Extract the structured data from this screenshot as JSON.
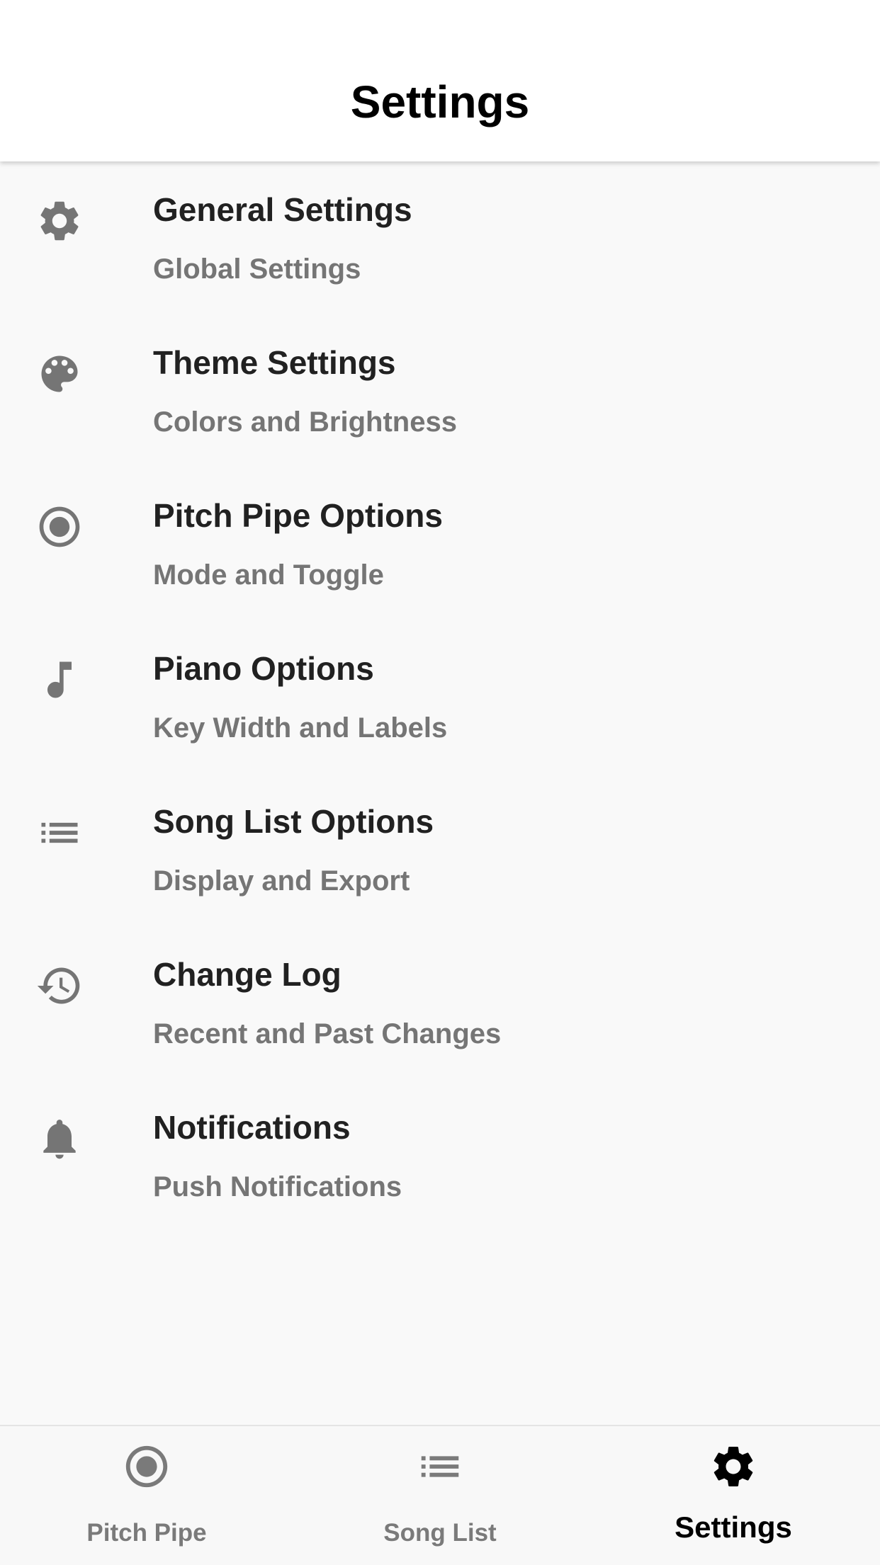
{
  "header": {
    "title": "Settings"
  },
  "items": [
    {
      "title": "General Settings",
      "subtitle": "Global Settings",
      "icon": "gear-icon"
    },
    {
      "title": "Theme Settings",
      "subtitle": "Colors and Brightness",
      "icon": "palette-icon"
    },
    {
      "title": "Pitch Pipe Options",
      "subtitle": "Mode and Toggle",
      "icon": "radio-button-icon"
    },
    {
      "title": "Piano Options",
      "subtitle": "Key Width and Labels",
      "icon": "music-note-icon"
    },
    {
      "title": "Song List Options",
      "subtitle": "Display and Export",
      "icon": "list-icon"
    },
    {
      "title": "Change Log",
      "subtitle": "Recent and Past Changes",
      "icon": "history-icon"
    },
    {
      "title": "Notifications",
      "subtitle": "Push Notifications",
      "icon": "bell-icon"
    }
  ],
  "tabs": [
    {
      "label": "Pitch Pipe",
      "icon": "radio-button-icon",
      "active": false
    },
    {
      "label": "Song List",
      "icon": "list-icon",
      "active": false
    },
    {
      "label": "Settings",
      "icon": "gear-icon",
      "active": true
    }
  ],
  "colors": {
    "icon_gray": "#757575",
    "active": "#000000",
    "inactive_tab": "#7a7a7a",
    "background": "#f9f9f9"
  }
}
